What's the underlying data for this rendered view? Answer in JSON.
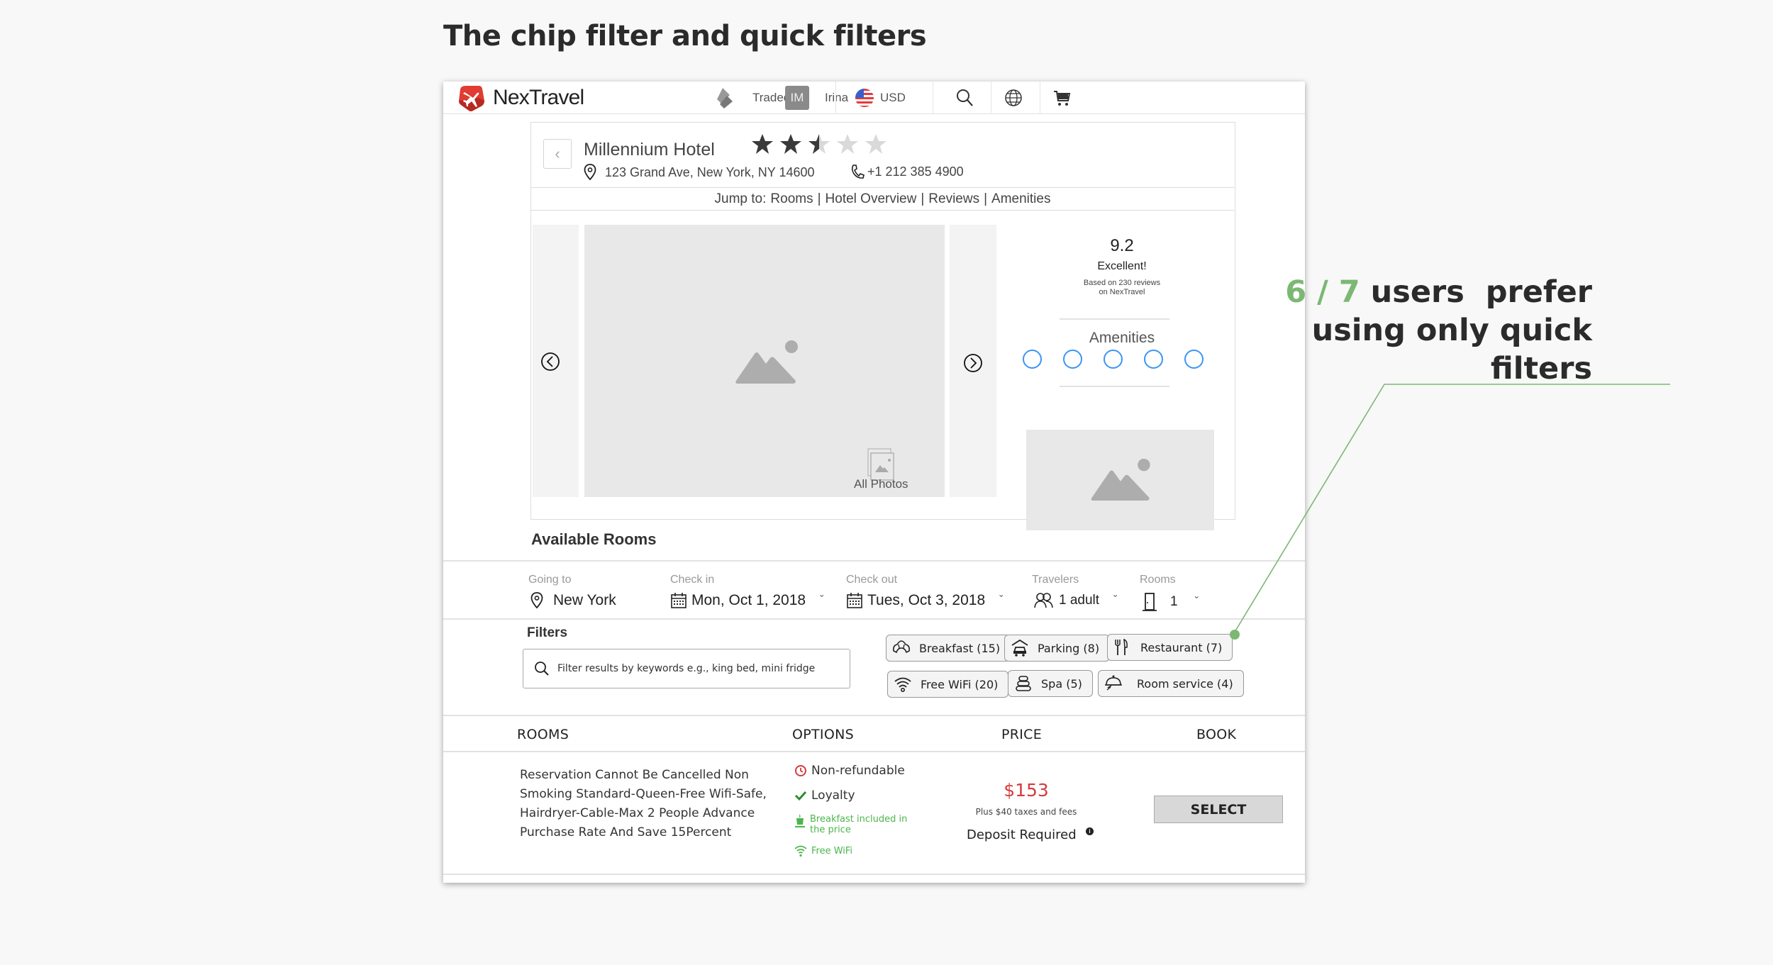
{
  "slide": {
    "title": "The chip filter and quick filters",
    "annotation": {
      "highlight": "6 / 7",
      "line1_rest": " users  prefer",
      "line2": "using only quick",
      "line3": "filters",
      "accent_color": "#7cb874"
    }
  },
  "header": {
    "brand": "NexTravel",
    "company": "Tradecraft",
    "user_initials": "IM",
    "user_name": "Irina",
    "currency": "USD",
    "icons": [
      "search-icon",
      "globe-icon",
      "cart-icon"
    ]
  },
  "hotel": {
    "name": "Millennium Hotel",
    "star_rating": 2.5,
    "star_max": 5,
    "address": "123 Grand Ave, New York, NY 14600",
    "phone": "+1 212 385 4900",
    "jump": {
      "prefix": "Jump to:",
      "links": [
        "Rooms",
        "Hotel Overview",
        "Reviews",
        "Amenities"
      ]
    },
    "gallery": {
      "all_photos_label": "All Photos"
    },
    "rating": {
      "score": "9.2",
      "label": "Excellent!",
      "sub_line1": "Based on 230 reviews",
      "sub_line2": "on NexTravel"
    },
    "amenities_title": "Amenities",
    "amenity_count": 5
  },
  "available_rooms": {
    "title": "Available Rooms",
    "search": {
      "going_to": {
        "label": "Going to",
        "value": "New York"
      },
      "check_in": {
        "label": "Check in",
        "value": "Mon, Oct 1, 2018"
      },
      "check_out": {
        "label": "Check out",
        "value": "Tues, Oct 3, 2018"
      },
      "travelers": {
        "label": "Travelers",
        "value": "1 adult"
      },
      "rooms": {
        "label": "Rooms",
        "value": "1"
      }
    },
    "filters": {
      "title": "Filters",
      "placeholder": "Filter results by keywords e.g., king bed, mini fridge",
      "value": "",
      "chips": [
        {
          "label": "Breakfast (15)",
          "icon": "croissant-icon"
        },
        {
          "label": "Parking (8)",
          "icon": "parking-garage-icon"
        },
        {
          "label": "Restaurant (7)",
          "icon": "fork-knife-icon"
        },
        {
          "label": "Free WiFi (20)",
          "icon": "wifi-icon"
        },
        {
          "label": "Spa (5)",
          "icon": "spa-stones-icon"
        },
        {
          "label": "Room service (4)",
          "icon": "cloche-icon"
        }
      ]
    },
    "table": {
      "headers": [
        "ROOMS",
        "OPTIONS",
        "PRICE",
        "BOOK"
      ],
      "rows": [
        {
          "description": "Reservation Cannot Be Cancelled Non Smoking Standard-Queen-Free Wifi-Safe, Hairdryer-Cable-Max 2 People Advance Purchase Rate And Save 15Percent",
          "options": {
            "refund": "Non-refundable",
            "loyalty": "Loyalty",
            "breakfast_line1": "Breakfast included in",
            "breakfast_line2": "the price",
            "wifi": "Free WiFi"
          },
          "price": "$153",
          "taxes": "Plus $40 taxes and fees",
          "deposit": "Deposit Required",
          "button": "SELECT"
        }
      ]
    }
  }
}
